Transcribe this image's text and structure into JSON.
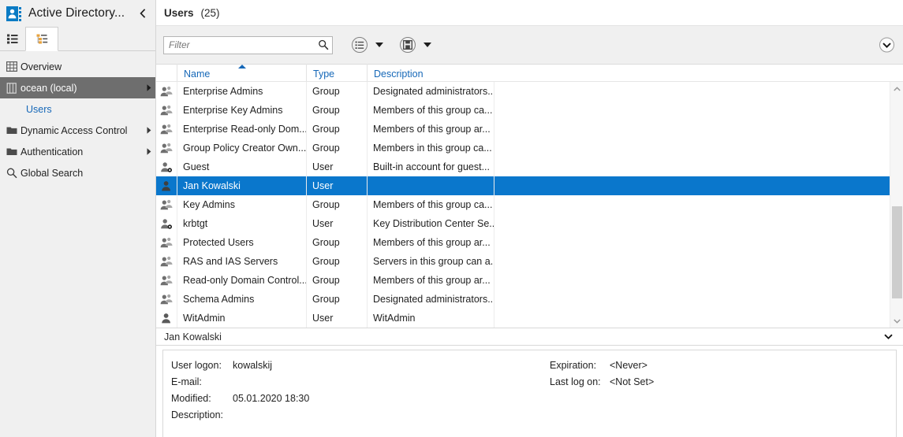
{
  "sidebar": {
    "app_icon": "user-badge-icon",
    "title": "Active Directory...",
    "collapse_icon": "chevron-left-icon",
    "tabs": [
      {
        "name": "list-view-tab",
        "icon": "list-icon"
      },
      {
        "name": "tree-view-tab",
        "icon": "tree-icon"
      }
    ],
    "items": [
      {
        "label": "Overview",
        "icon": "grid-icon",
        "has_arrow": false,
        "selected": false,
        "child": false
      },
      {
        "label": "ocean (local)",
        "icon": "server-icon",
        "has_arrow": true,
        "selected": true,
        "child": false
      },
      {
        "label": "Users",
        "icon": "",
        "has_arrow": false,
        "selected": false,
        "child": true
      },
      {
        "label": "Dynamic Access Control",
        "icon": "folder-icon",
        "has_arrow": true,
        "selected": false,
        "child": false
      },
      {
        "label": "Authentication",
        "icon": "folder-icon",
        "has_arrow": true,
        "selected": false,
        "child": false
      },
      {
        "label": "Global Search",
        "icon": "magnifier-icon",
        "has_arrow": false,
        "selected": false,
        "child": false
      }
    ]
  },
  "header": {
    "title": "Users",
    "count": "(25)"
  },
  "toolbar": {
    "filter_placeholder": "Filter",
    "filter_value": "",
    "search_icon": "search-icon",
    "buttons": [
      {
        "name": "tasks-menu-button",
        "icon": "list-circle-icon",
        "caret": "caret-down-icon"
      },
      {
        "name": "manage-menu-button",
        "icon": "save-circle-icon",
        "caret": "caret-down-icon"
      }
    ],
    "expand_icon": "chevron-down-circle-icon"
  },
  "table": {
    "columns": [
      {
        "label": "",
        "key": "icon"
      },
      {
        "label": "Name",
        "key": "name",
        "sorted": "asc"
      },
      {
        "label": "Type",
        "key": "type"
      },
      {
        "label": "Description",
        "key": "description"
      }
    ],
    "rows": [
      {
        "icon": "group-icon",
        "name": "Enterprise Admins",
        "type": "Group",
        "description": "Designated administrators...",
        "selected": false
      },
      {
        "icon": "group-icon",
        "name": "Enterprise Key Admins",
        "type": "Group",
        "description": "Members of this group ca...",
        "selected": false
      },
      {
        "icon": "group-icon",
        "name": "Enterprise Read-only Dom...",
        "type": "Group",
        "description": "Members of this group ar...",
        "selected": false
      },
      {
        "icon": "group-icon",
        "name": "Group Policy Creator Own...",
        "type": "Group",
        "description": "Members in this group ca...",
        "selected": false
      },
      {
        "icon": "user-disabled-icon",
        "name": "Guest",
        "type": "User",
        "description": "Built-in account for guest...",
        "selected": false
      },
      {
        "icon": "user-icon",
        "name": "Jan Kowalski",
        "type": "User",
        "description": "",
        "selected": true
      },
      {
        "icon": "group-icon",
        "name": "Key Admins",
        "type": "Group",
        "description": "Members of this group ca...",
        "selected": false
      },
      {
        "icon": "user-disabled-icon",
        "name": "krbtgt",
        "type": "User",
        "description": "Key Distribution Center Se...",
        "selected": false
      },
      {
        "icon": "group-icon",
        "name": "Protected Users",
        "type": "Group",
        "description": "Members of this group ar...",
        "selected": false
      },
      {
        "icon": "group-icon",
        "name": "RAS and IAS Servers",
        "type": "Group",
        "description": "Servers in this group can a...",
        "selected": false
      },
      {
        "icon": "group-icon",
        "name": "Read-only Domain Control...",
        "type": "Group",
        "description": "Members of this group ar...",
        "selected": false
      },
      {
        "icon": "group-icon",
        "name": "Schema Admins",
        "type": "Group",
        "description": "Designated administrators...",
        "selected": false
      },
      {
        "icon": "user-icon",
        "name": "WitAdmin",
        "type": "User",
        "description": "WitAdmin",
        "selected": false
      }
    ],
    "scrollbar": {
      "up_icon": "chevron-up-icon",
      "down_icon": "chevron-down-icon"
    }
  },
  "detail": {
    "title": "Jan Kowalski",
    "collapse_icon": "chevron-down-icon",
    "left_fields": [
      {
        "key": "User logon:",
        "value": "kowalskij"
      },
      {
        "key": "E-mail:",
        "value": ""
      },
      {
        "key": "Modified:",
        "value": "05.01.2020 18:30"
      },
      {
        "key": "Description:",
        "value": ""
      }
    ],
    "right_fields": [
      {
        "key": "Expiration:",
        "value": "<Never>"
      },
      {
        "key": "Last log on:",
        "value": "<Not Set>"
      }
    ]
  },
  "colors": {
    "accent": "#0a77cc",
    "link": "#1668b8",
    "sidebar_bg": "#f0f0f0",
    "selected_sidebar": "#6e6e6e"
  }
}
